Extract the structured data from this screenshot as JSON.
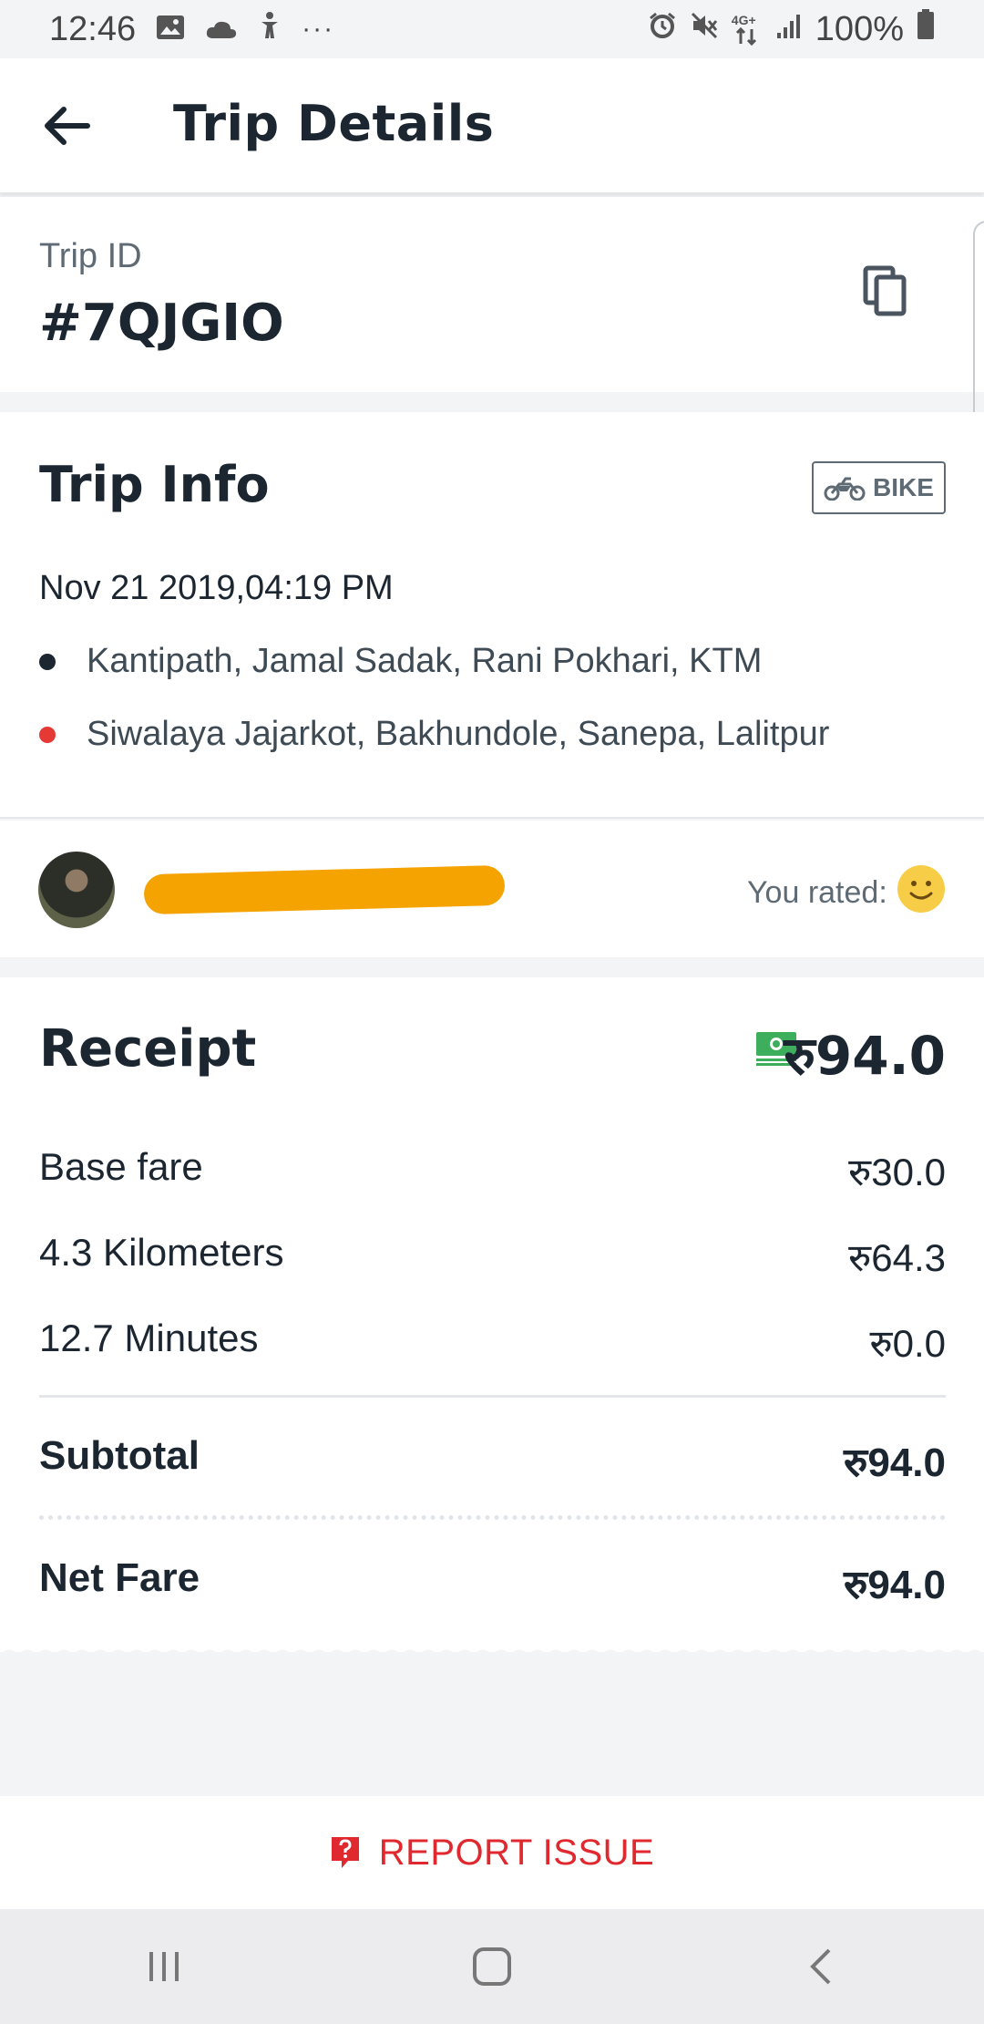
{
  "status_bar": {
    "time": "12:46",
    "more": "···",
    "battery": "100%",
    "network": "4G+"
  },
  "app_bar": {
    "title": "Trip Details"
  },
  "trip_id": {
    "label": "Trip ID",
    "value": "#7QJGIO"
  },
  "trip_info": {
    "title": "Trip Info",
    "vehicle": "BIKE",
    "datetime": "Nov 21 2019,04:19 PM",
    "pickup": "Kantipath, Jamal Sadak, Rani Pokhari, KTM",
    "drop": "Siwalaya Jajarkot, Bakhundole, Sanepa, Lalitpur"
  },
  "driver": {
    "rated_label": "You rated:"
  },
  "receipt": {
    "title": "Receipt",
    "total": "रु94.0",
    "rows": [
      {
        "label": "Base fare",
        "value": "रु30.0"
      },
      {
        "label": "4.3 Kilometers",
        "value": "रु64.3"
      },
      {
        "label": "12.7 Minutes",
        "value": "रु0.0"
      }
    ],
    "subtotal_label": "Subtotal",
    "subtotal_value": "रु94.0",
    "net_label": "Net Fare",
    "net_value": "रु94.0"
  },
  "report": {
    "label": "REPORT ISSUE"
  },
  "colors": {
    "accent_red": "#e0282f",
    "text_dark": "#1b2631",
    "pickup_dot": "#1b2631",
    "drop_dot": "#e53935",
    "cash_green": "#3cae5c",
    "redaction": "#f5a300"
  }
}
